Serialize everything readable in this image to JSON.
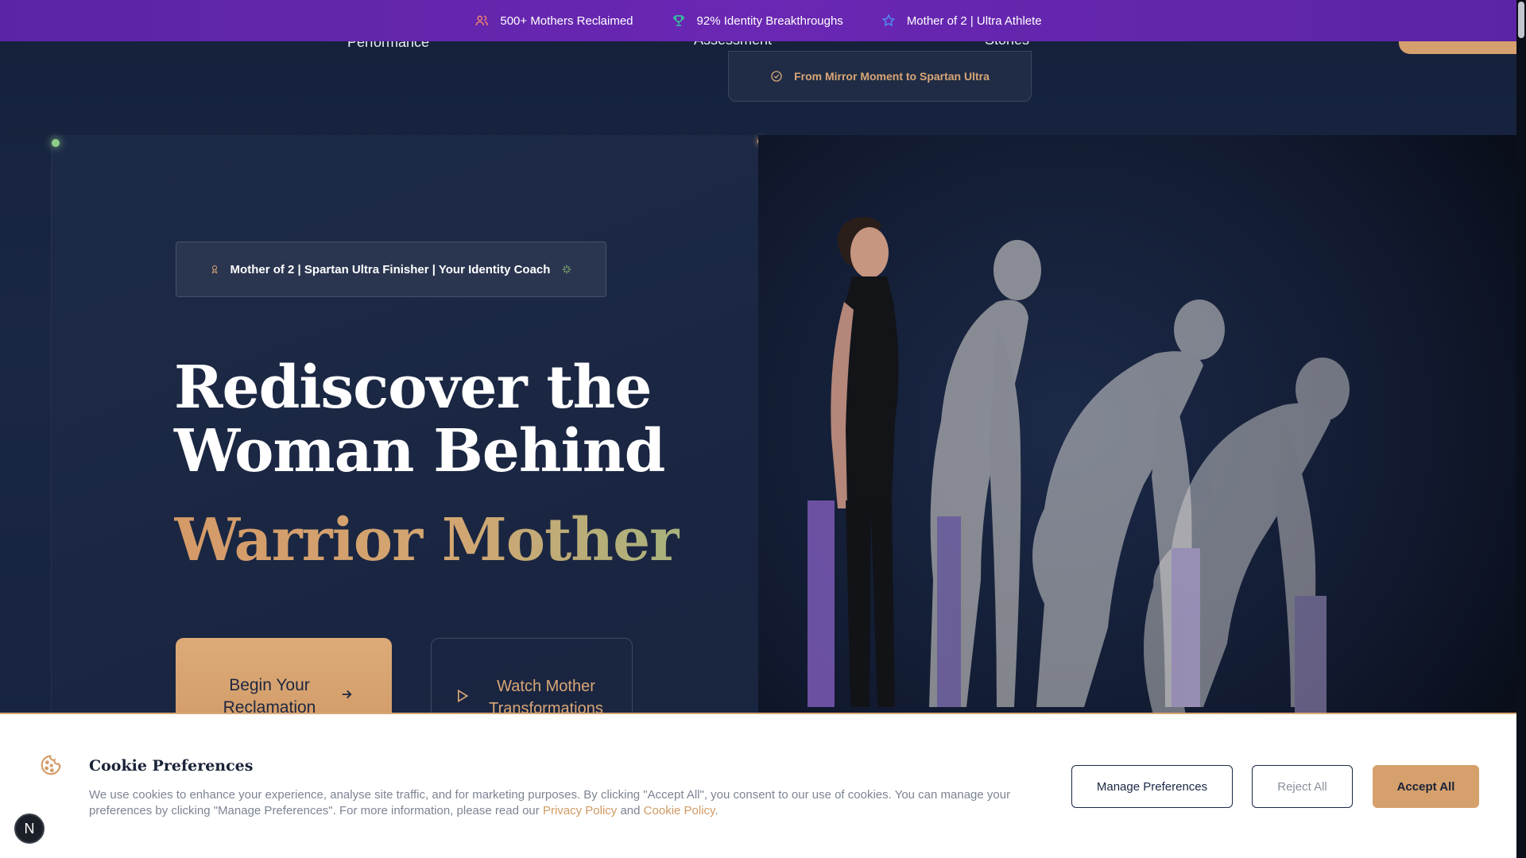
{
  "topbar": {
    "items": [
      {
        "label": "500+ Mothers Reclaimed",
        "icon": "users-icon",
        "color": "#f2836b"
      },
      {
        "label": "92% Identity Breakthroughs",
        "icon": "trophy-icon",
        "color": "#2fd09a"
      },
      {
        "label": "Mother of 2 | Ultra Athlete",
        "icon": "star-icon",
        "color": "#4f8df5"
      }
    ]
  },
  "nav": {
    "performance_label": "Performance",
    "assessment_label": "Assessment",
    "stories_label": "Stories",
    "dropdown_item": "From Mirror Moment to Spartan Ultra"
  },
  "hero": {
    "badge_text": "Mother of 2 | Spartan Ultra Finisher | Your Identity Coach",
    "title_line1": "Rediscover the",
    "title_line2": "Woman Behind",
    "accent": "Warrior Mother",
    "primary_button": "Begin Your Reclamation",
    "secondary_button": "Watch Mother Transformations"
  },
  "cookie": {
    "title": "Cookie Preferences",
    "body_before": "We use cookies to enhance your experience, analyse site traffic, and for marketing purposes. By clicking \"Accept All\", you consent to our use of cookies. You can manage your preferences by clicking \"Manage Preferences\". For more information, please read our ",
    "privacy_link": "Privacy Policy",
    "and_text": " and ",
    "cookie_link": "Cookie Policy",
    "period": ".",
    "manage_button": "Manage Preferences",
    "reject_button": "Reject All",
    "accept_button": "Accept All"
  },
  "floating_badge": "N",
  "colors": {
    "topbar": "#6a27b3",
    "accent_gold": "#d6a06c",
    "navy": "#1a2744"
  }
}
